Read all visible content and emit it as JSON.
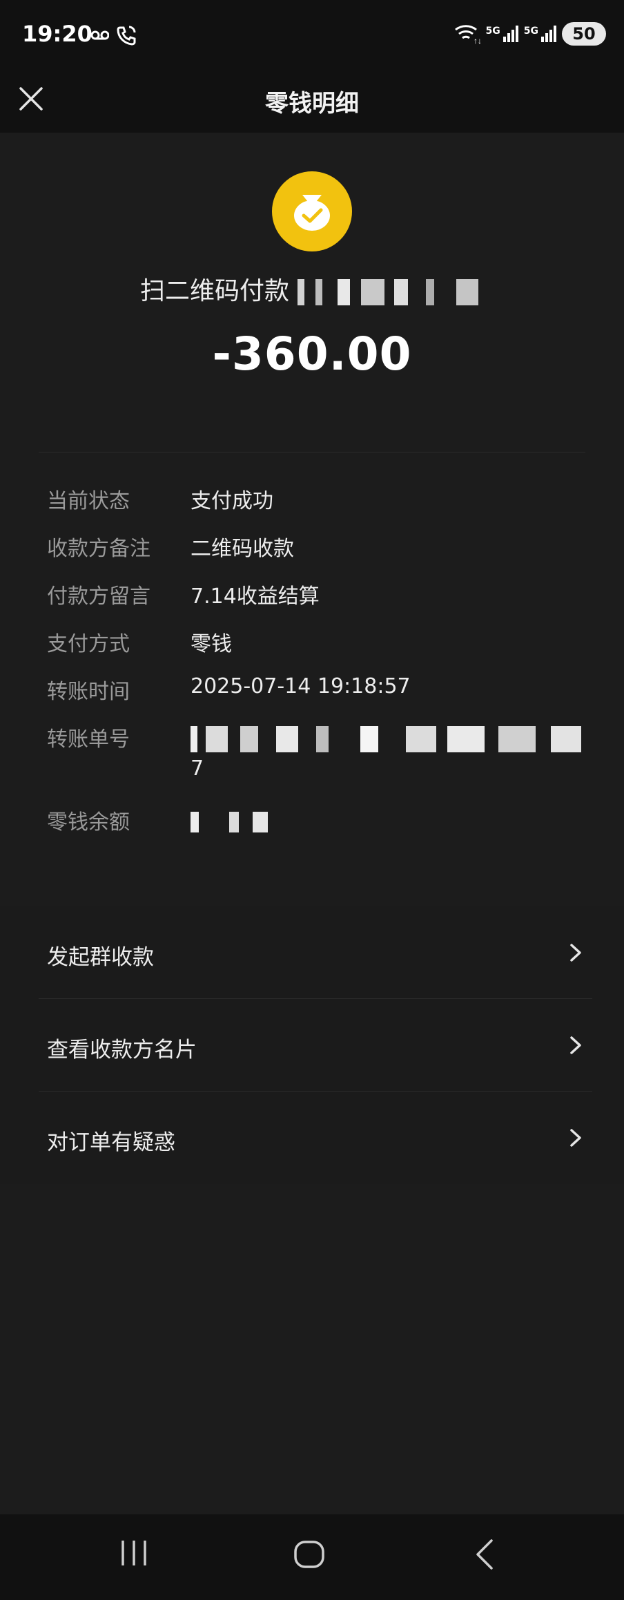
{
  "status_bar": {
    "time": "19:20",
    "icons_left": [
      "voicemail-icon",
      "phone-wifi-call-icon"
    ],
    "icons_right": [
      "wifi-6-icon",
      "5g-signal-icon",
      "5g-signal-icon"
    ],
    "net1": "5G",
    "net2": "5G",
    "battery": "50"
  },
  "nav": {
    "title": "零钱明细"
  },
  "hero": {
    "icon": "money-bag-check-icon",
    "type_label": "扫二维码付款",
    "amount": "-360.00"
  },
  "details": [
    {
      "label": "当前状态",
      "value": "支付成功"
    },
    {
      "label": "收款方备注",
      "value": "二维码收款"
    },
    {
      "label": "付款方留言",
      "value": "7.14收益结算"
    },
    {
      "label": "支付方式",
      "value": "零钱"
    },
    {
      "label": "转账时间",
      "value": "2025-07-14 19:18:57"
    },
    {
      "label": "转账单号",
      "value_tail": "7"
    },
    {
      "label": "零钱余额"
    }
  ],
  "menu": [
    {
      "label": "发起群收款"
    },
    {
      "label": "查看收款方名片"
    },
    {
      "label": "对订单有疑惑"
    }
  ],
  "colors": {
    "background": "#1c1c1c",
    "bar": "#111111",
    "coin": "#f2c20f",
    "label": "#9a9a9a",
    "value": "#ededed"
  }
}
